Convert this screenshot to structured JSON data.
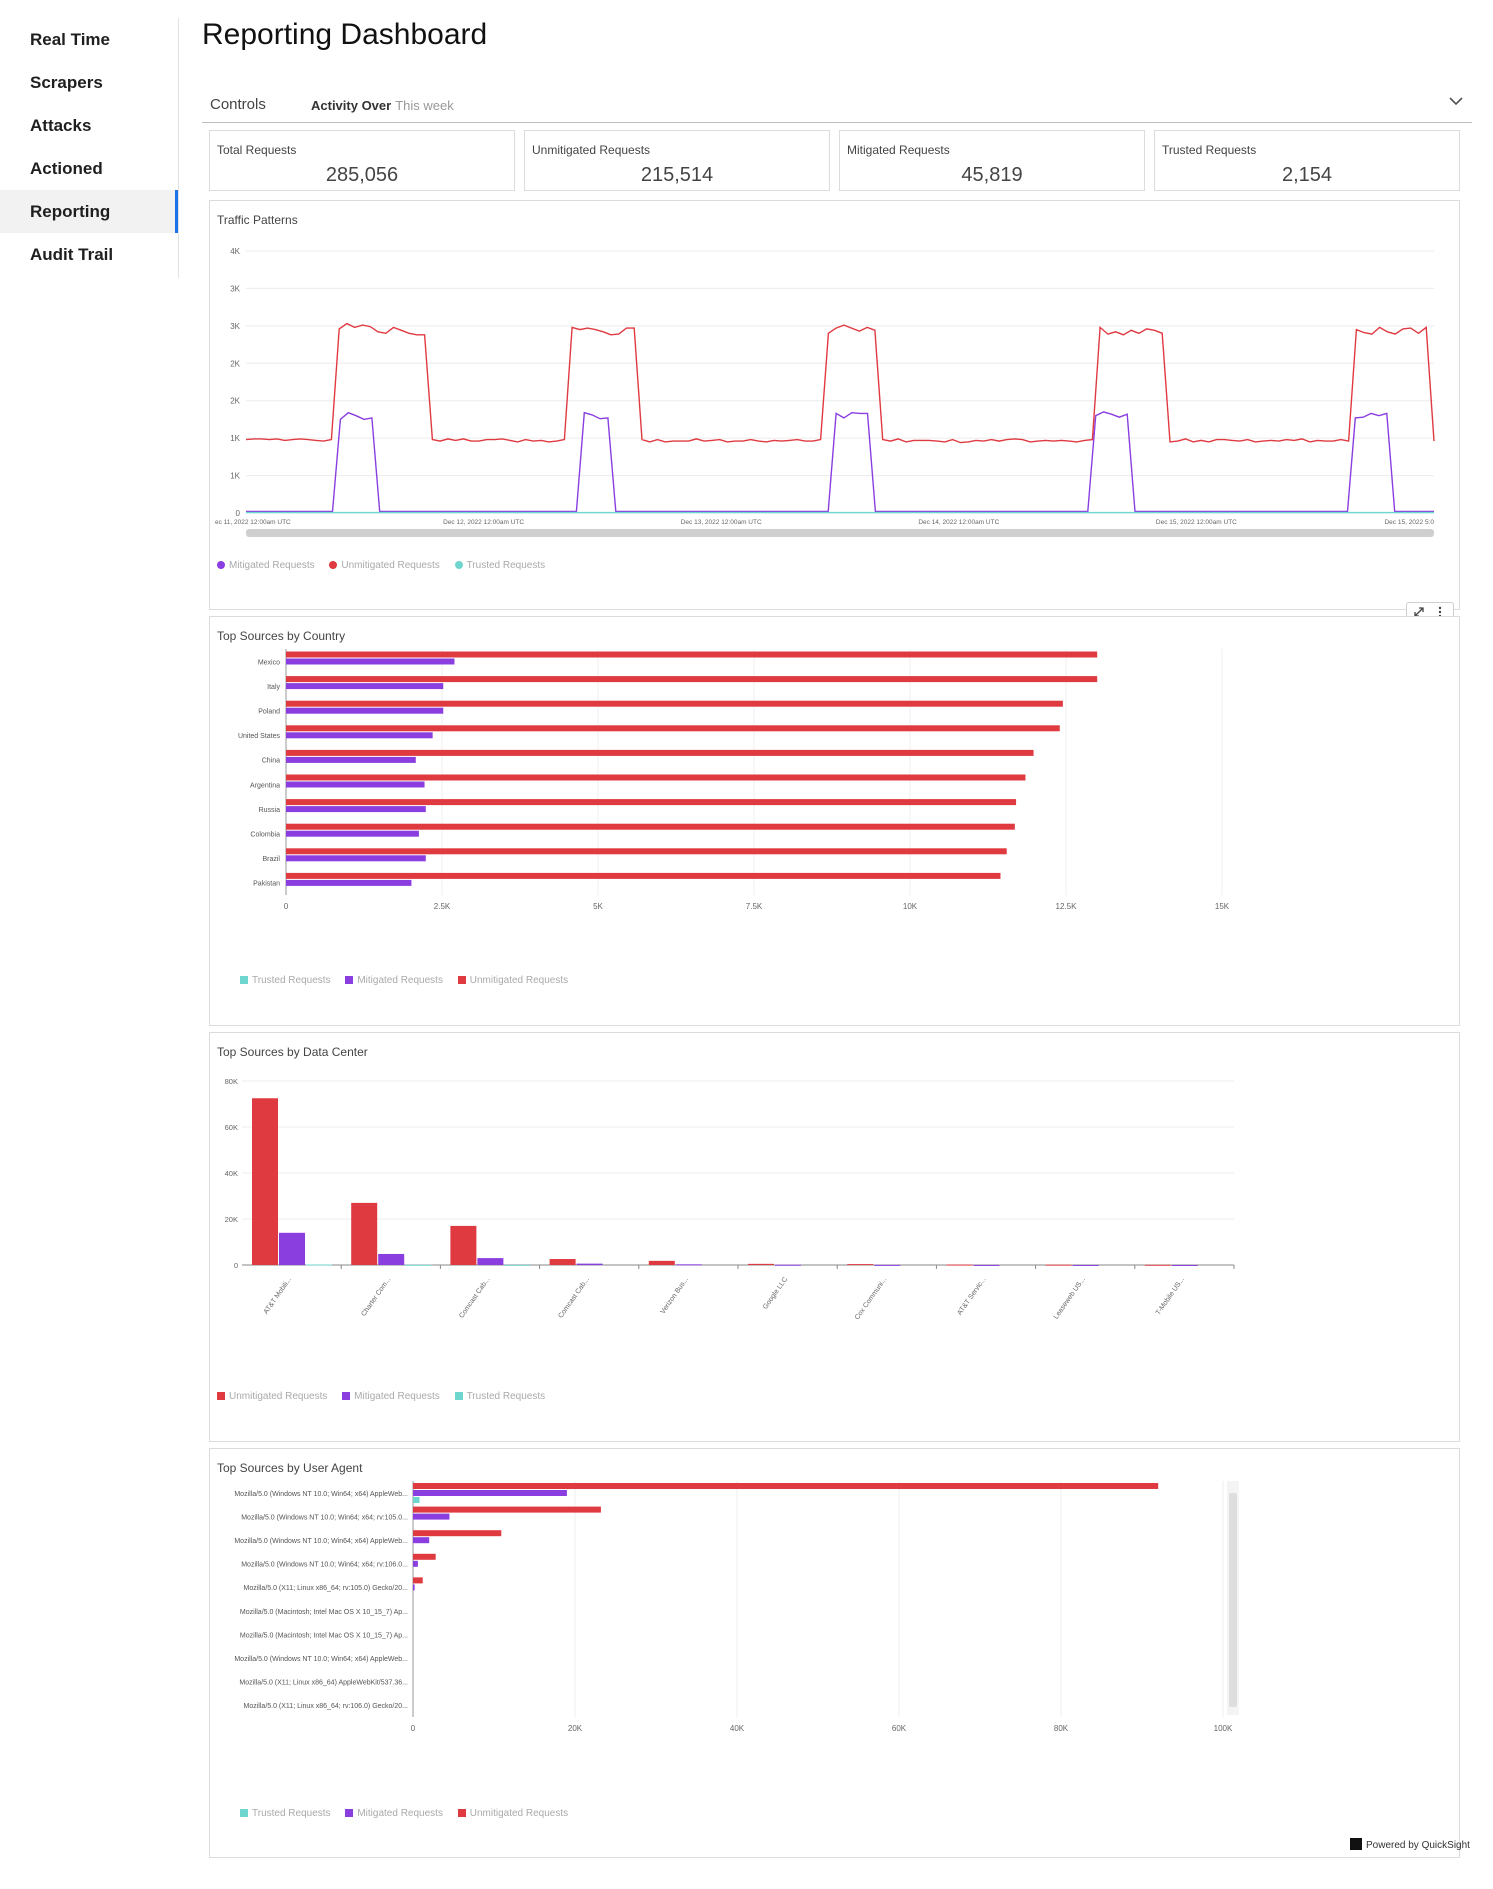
{
  "sidebar": {
    "items": [
      {
        "label": "Real Time"
      },
      {
        "label": "Scrapers"
      },
      {
        "label": "Attacks"
      },
      {
        "label": "Actioned"
      },
      {
        "label": "Reporting",
        "active": true
      },
      {
        "label": "Audit Trail"
      }
    ]
  },
  "page_title": "Reporting Dashboard",
  "controls": {
    "label": "Controls",
    "activity_label": "Activity Over",
    "activity_value": "This week"
  },
  "kpis": [
    {
      "label": "Total Requests",
      "value": "285,056"
    },
    {
      "label": "Unmitigated Requests",
      "value": "215,514"
    },
    {
      "label": "Mitigated Requests",
      "value": "45,819"
    },
    {
      "label": "Trusted Requests",
      "value": "2,154"
    }
  ],
  "colors": {
    "unmitigated": "#e03a41",
    "mitigated": "#8a3ee0",
    "trusted": "#6fd6cf"
  },
  "icons": {
    "expand": "expand-icon",
    "more": "more-vert-icon",
    "chevron": "chevron-down-icon",
    "quicksight": "quicksight-logo-icon"
  },
  "footer": {
    "powered_by": "Powered by QuickSight"
  },
  "chart_data": [
    {
      "type": "line",
      "title": "Traffic Patterns",
      "y_tick_labels": [
        "0",
        "1K",
        "1K",
        "2K",
        "2K",
        "3K",
        "3K",
        "4K"
      ],
      "x_tick_labels": [
        "ec 11, 2022 12:00am UTC",
        "Dec 12, 2022 12:00am UTC",
        "Dec 13, 2022 12:00am UTC",
        "Dec 14, 2022 12:00am UTC",
        "Dec 15, 2022 12:00am UTC",
        "Dec 15, 2022 5:0"
      ],
      "ylim": [
        0,
        3500
      ],
      "legend_position": "bottom-left",
      "series": [
        {
          "name": "Mitigated Requests",
          "values": [
            20,
            20,
            20,
            20,
            20,
            20,
            20,
            20,
            20,
            20,
            20,
            20,
            1250,
            1340,
            1300,
            1250,
            1270,
            20,
            20,
            20,
            20,
            20,
            20,
            20,
            20,
            20,
            20,
            20,
            20,
            20,
            20,
            20,
            20,
            20,
            20,
            20,
            20,
            20,
            20,
            20,
            20,
            20,
            20,
            1340,
            1310,
            1260,
            1270,
            20,
            20,
            20,
            20,
            20,
            20,
            20,
            20,
            20,
            20,
            20,
            20,
            20,
            20,
            20,
            20,
            20,
            20,
            20,
            20,
            20,
            20,
            20,
            20,
            20,
            20,
            20,
            20,
            1330,
            1270,
            1340,
            1330,
            1330,
            20,
            20,
            20,
            20,
            20,
            20,
            20,
            20,
            20,
            20,
            20,
            20,
            20,
            20,
            20,
            20,
            20,
            20,
            20,
            20,
            20,
            20,
            20,
            20,
            20,
            20,
            20,
            20,
            1300,
            1350,
            1320,
            1280,
            1320,
            20,
            20,
            20,
            20,
            20,
            20,
            20,
            20,
            20,
            20,
            20,
            20,
            20,
            20,
            20,
            20,
            20,
            20,
            20,
            20,
            20,
            20,
            20,
            20,
            20,
            20,
            20,
            20,
            1270,
            1280,
            1330,
            1300,
            1330,
            20,
            20,
            20,
            20,
            20,
            20
          ]
        },
        {
          "name": "Unmitigated Requests",
          "values": [
            980,
            990,
            990,
            980,
            990,
            970,
            980,
            990,
            980,
            970,
            960,
            980,
            2460,
            2530,
            2480,
            2510,
            2490,
            2420,
            2400,
            2480,
            2440,
            2400,
            2380,
            2380,
            980,
            960,
            990,
            970,
            990,
            960,
            960,
            980,
            980,
            990,
            970,
            950,
            980,
            960,
            970,
            950,
            960,
            980,
            2480,
            2450,
            2470,
            2450,
            2420,
            2380,
            2390,
            2470,
            2470,
            980,
            950,
            980,
            950,
            960,
            960,
            960,
            990,
            960,
            970,
            980,
            950,
            960,
            960,
            980,
            960,
            950,
            970,
            960,
            970,
            980,
            960,
            960,
            980,
            2400,
            2470,
            2510,
            2470,
            2430,
            2480,
            2440,
            980,
            960,
            990,
            950,
            970,
            970,
            970,
            960,
            950,
            980,
            940,
            950,
            970,
            960,
            980,
            960,
            980,
            990,
            980,
            950,
            960,
            970,
            960,
            970,
            960,
            950,
            970,
            980,
            2480,
            2390,
            2420,
            2380,
            2440,
            2400,
            2460,
            2440,
            2400,
            950,
            960,
            990,
            950,
            970,
            950,
            980,
            980,
            970,
            960,
            980,
            950,
            960,
            970,
            960,
            980,
            970,
            990,
            950,
            970,
            960,
            960,
            980,
            960,
            2450,
            2410,
            2390,
            2480,
            2420,
            2390,
            2460,
            2470,
            2400,
            2480,
            960
          ]
        },
        {
          "name": "Trusted Requests",
          "values": [
            5,
            5,
            5,
            5,
            5,
            5,
            5,
            5,
            5,
            5,
            5,
            5,
            5,
            5,
            5,
            5,
            5,
            5,
            5,
            5,
            5,
            5,
            5,
            5,
            5,
            5,
            5,
            5,
            5,
            5,
            5,
            5,
            5,
            5,
            5,
            5,
            5,
            5,
            5,
            5,
            5,
            5,
            5,
            5,
            5,
            5,
            5,
            5,
            5,
            5,
            5,
            5,
            5,
            5,
            5,
            5,
            5,
            5,
            5,
            5,
            5,
            5,
            5,
            5,
            5,
            5,
            5,
            5,
            5,
            5,
            5,
            5,
            5,
            5,
            5,
            5,
            5,
            5,
            5,
            5,
            5,
            5,
            5,
            5,
            5,
            5,
            5,
            5,
            5,
            5,
            5,
            5,
            5,
            5,
            5,
            5,
            5,
            5,
            5,
            5,
            5,
            5,
            5,
            5,
            5,
            5,
            5,
            5,
            5,
            5,
            5,
            5,
            5,
            5,
            5,
            5,
            5,
            5,
            5,
            5,
            5,
            5,
            5,
            5,
            5,
            5,
            5,
            5,
            5,
            5,
            5,
            5,
            5,
            5,
            5,
            5,
            5,
            5,
            5,
            5,
            5,
            5,
            5,
            5,
            5,
            5,
            5,
            5,
            5,
            5,
            5,
            5
          ]
        }
      ]
    },
    {
      "type": "bar",
      "orientation": "horizontal",
      "title": "Top Sources by Country",
      "categories": [
        "Mexico",
        "Italy",
        "Poland",
        "United States",
        "China",
        "Argentina",
        "Russia",
        "Colombia",
        "Brazil",
        "Pakistan"
      ],
      "x_tick_labels": [
        "0",
        "2.5K",
        "5K",
        "7.5K",
        "10K",
        "12.5K",
        "15K"
      ],
      "xlim": [
        0,
        15000
      ],
      "legend_position": "bottom-left",
      "series": [
        {
          "name": "Trusted Requests",
          "values": [
            0,
            0,
            0,
            0,
            0,
            0,
            0,
            0,
            0,
            0
          ]
        },
        {
          "name": "Mitigated Requests",
          "values": [
            2700,
            2520,
            2520,
            2350,
            2080,
            2220,
            2240,
            2130,
            2240,
            2010
          ]
        },
        {
          "name": "Unmitigated Requests",
          "values": [
            13000,
            13000,
            12450,
            12400,
            11980,
            11850,
            11700,
            11680,
            11550,
            11450
          ]
        }
      ]
    },
    {
      "type": "bar",
      "orientation": "vertical",
      "title": "Top Sources by Data Center",
      "categories": [
        "AT&T Mobili...",
        "Charter Com...",
        "Comcast Cab...",
        "Comcast Cab...",
        "Verizon Bus...",
        "Google LLC",
        "Cox Communi...",
        "AT&T Servic...",
        "Leaseweb US...",
        "T-Mobile US..."
      ],
      "y_tick_labels": [
        "0",
        "20K",
        "40K",
        "60K",
        "80K"
      ],
      "ylim": [
        0,
        80000
      ],
      "legend_position": "bottom-left",
      "series": [
        {
          "name": "Unmitigated Requests",
          "values": [
            72500,
            27000,
            17000,
            2600,
            1800,
            500,
            400,
            200,
            150,
            100
          ]
        },
        {
          "name": "Mitigated Requests",
          "values": [
            14000,
            4800,
            3000,
            600,
            300,
            100,
            50,
            30,
            20,
            10
          ]
        },
        {
          "name": "Trusted Requests",
          "values": [
            200,
            100,
            50,
            0,
            0,
            0,
            0,
            0,
            0,
            0
          ]
        }
      ]
    },
    {
      "type": "bar",
      "orientation": "horizontal",
      "title": "Top Sources by User Agent",
      "categories": [
        "Mozilla/5.0 (Windows NT 10.0; Win64; x64) AppleWeb...",
        "Mozilla/5.0 (Windows NT 10.0; Win64; x64; rv:105.0...",
        "Mozilla/5.0 (Windows NT 10.0; Win64; x64) AppleWeb...",
        "Mozilla/5.0 (Windows NT 10.0; Win64; x64; rv:106.0...",
        "Mozilla/5.0 (X11; Linux x86_64; rv:105.0) Gecko/20...",
        "Mozilla/5.0 (Macintosh; Intel Mac OS X 10_15_7) Ap...",
        "Mozilla/5.0 (Macintosh; Intel Mac OS X 10_15_7) Ap...",
        "Mozilla/5.0 (Windows NT 10.0; Win64; x64) AppleWeb...",
        "Mozilla/5.0 (X11; Linux x86_64) AppleWebKit/537.36...",
        "Mozilla/5.0 (X11; Linux x86_64; rv:106.0) Gecko/20..."
      ],
      "x_tick_labels": [
        "0",
        "20K",
        "40K",
        "60K",
        "80K",
        "100K"
      ],
      "xlim": [
        0,
        100000
      ],
      "legend_position": "bottom-left",
      "series": [
        {
          "name": "Trusted Requests",
          "values": [
            800,
            0,
            0,
            0,
            0,
            0,
            0,
            0,
            0,
            0
          ]
        },
        {
          "name": "Mitigated Requests",
          "values": [
            19000,
            4500,
            2000,
            600,
            200,
            0,
            0,
            0,
            0,
            0
          ]
        },
        {
          "name": "Unmitigated Requests",
          "values": [
            92000,
            23200,
            10900,
            2800,
            1200,
            0,
            0,
            0,
            0,
            0
          ]
        }
      ]
    }
  ]
}
